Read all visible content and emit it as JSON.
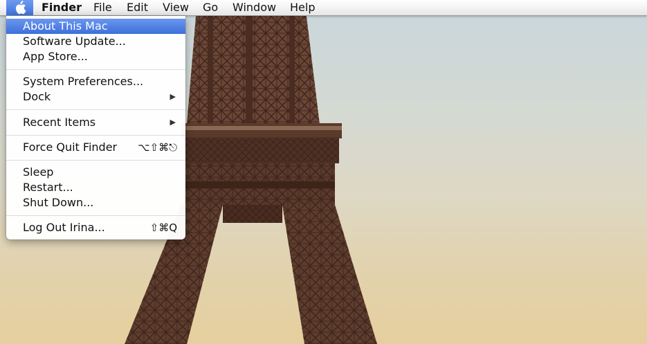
{
  "menubar": {
    "apple_icon": "apple-logo-icon",
    "items": [
      "Finder",
      "File",
      "Edit",
      "View",
      "Go",
      "Window",
      "Help"
    ]
  },
  "apple_menu": {
    "items": [
      {
        "label": "About This Mac",
        "selected": true
      },
      {
        "label": "Software Update..."
      },
      {
        "label": "App Store..."
      },
      {
        "label": "System Preferences..."
      },
      {
        "label": "Dock",
        "submenu": true
      },
      {
        "label": "Recent Items",
        "submenu": true
      },
      {
        "label": "Force Quit Finder",
        "shortcut": "⌥⇧⌘⎋"
      },
      {
        "label": "Sleep"
      },
      {
        "label": "Restart..."
      },
      {
        "label": "Shut Down..."
      },
      {
        "label": "Log Out Irina...",
        "shortcut": "⇧⌘Q"
      }
    ]
  },
  "colors": {
    "selection": "#3e6fdc",
    "tower": "#5a3a2c"
  }
}
